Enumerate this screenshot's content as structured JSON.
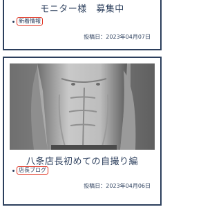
{
  "posts": [
    {
      "title": "モニター様　募集中",
      "tag": "新着情報",
      "date": "投稿日：2023年04月07日"
    },
    {
      "title": "八条店長初めての自撮り編",
      "tag": "店長ブログ",
      "date": "投稿日：2023年04月06日",
      "image": "monochrome-torso-photo"
    }
  ],
  "colors": {
    "accent_border": "#2b3e5c",
    "tag_outline": "#e0301e"
  }
}
